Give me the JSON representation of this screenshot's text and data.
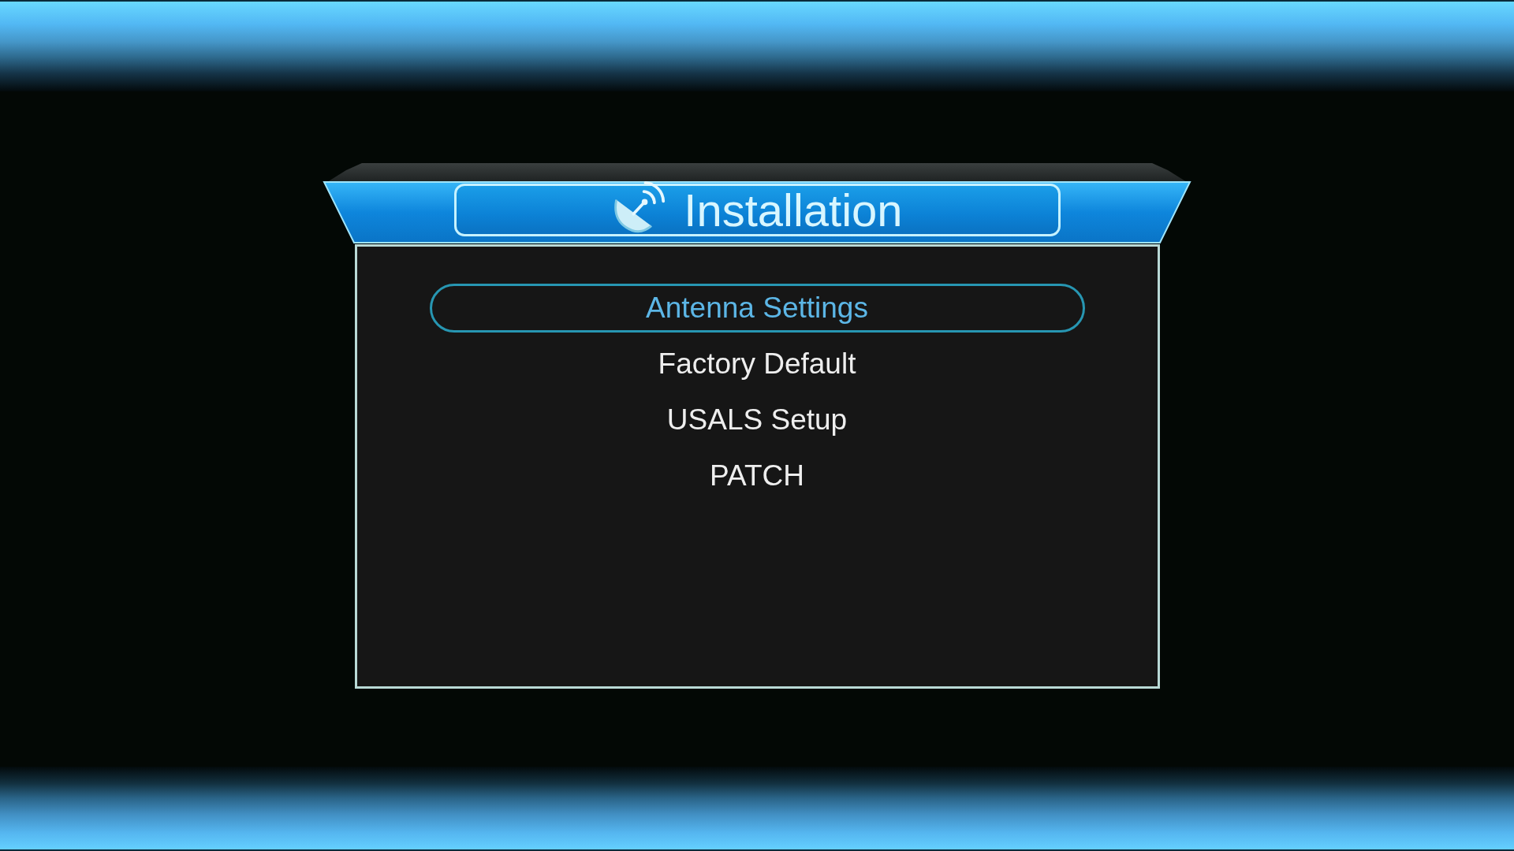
{
  "window": {
    "title": "Installation"
  },
  "menu": {
    "items": [
      {
        "label": "Antenna Settings",
        "selected": true
      },
      {
        "label": "Factory Default",
        "selected": false
      },
      {
        "label": "USALS Setup",
        "selected": false
      },
      {
        "label": "PATCH",
        "selected": false
      }
    ]
  }
}
